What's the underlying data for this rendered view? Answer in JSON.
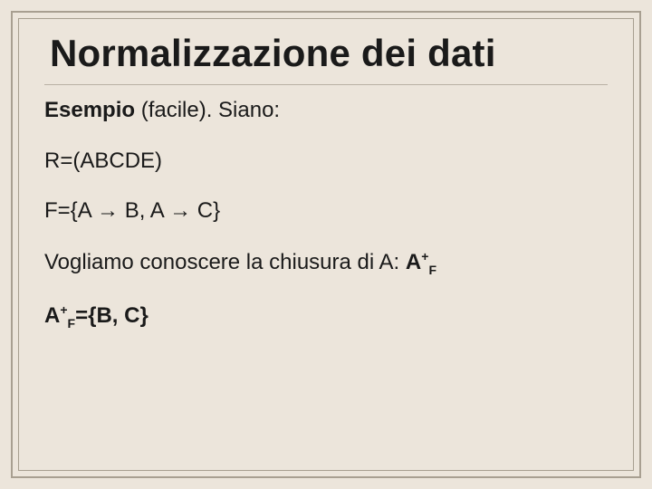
{
  "title": "Normalizzazione dei dati",
  "lines": {
    "l1": "Esempio (facile). Siano:",
    "l2": "R=(ABCDE)",
    "l3": "F={A → B, A → C}",
    "l4_pre": "Vogliamo conoscere la chiusura di A: ",
    "l4_bold_base": "A",
    "l4_bold_sup": "+",
    "l4_bold_sub": "F",
    "l5_base": "A",
    "l5_sup": "+",
    "l5_sub": "F",
    "l5_rest": "={B, C}"
  }
}
